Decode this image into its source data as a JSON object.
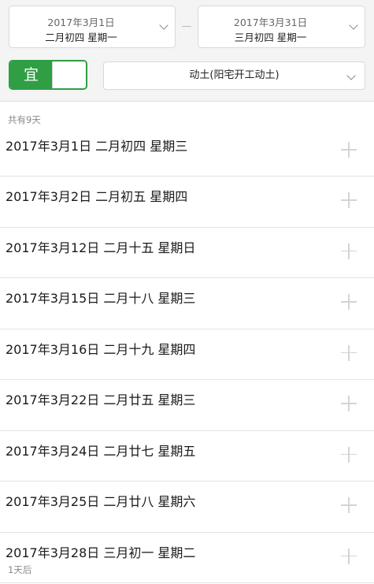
{
  "filters": {
    "start_date": {
      "gregorian": "2017年3月1日",
      "lunar": "二月初四 星期一"
    },
    "end_date": {
      "gregorian": "2017年3月31日",
      "lunar": "三月初四 星期一"
    },
    "toggle_label": "宜",
    "activity": "动土(阳宅开工动土)"
  },
  "result_count": "共有9天",
  "results": [
    {
      "date": "2017年3月1日 二月初四 星期三",
      "note": ""
    },
    {
      "date": "2017年3月2日 二月初五 星期四",
      "note": ""
    },
    {
      "date": "2017年3月12日 二月十五 星期日",
      "note": ""
    },
    {
      "date": "2017年3月15日 二月十八 星期三",
      "note": ""
    },
    {
      "date": "2017年3月16日 二月十九 星期四",
      "note": ""
    },
    {
      "date": "2017年3月22日 二月廿五 星期三",
      "note": ""
    },
    {
      "date": "2017年3月24日 二月廿七 星期五",
      "note": ""
    },
    {
      "date": "2017年3月25日 二月廿八 星期六",
      "note": ""
    },
    {
      "date": "2017年3月28日 三月初一 星期二",
      "note": "1天后"
    }
  ],
  "colors": {
    "accent": "#2f9e44",
    "divider": "#e4e4e4",
    "muted": "#888888"
  },
  "icons": {
    "dropdown": "chevron-down-icon",
    "add": "plus-icon"
  }
}
